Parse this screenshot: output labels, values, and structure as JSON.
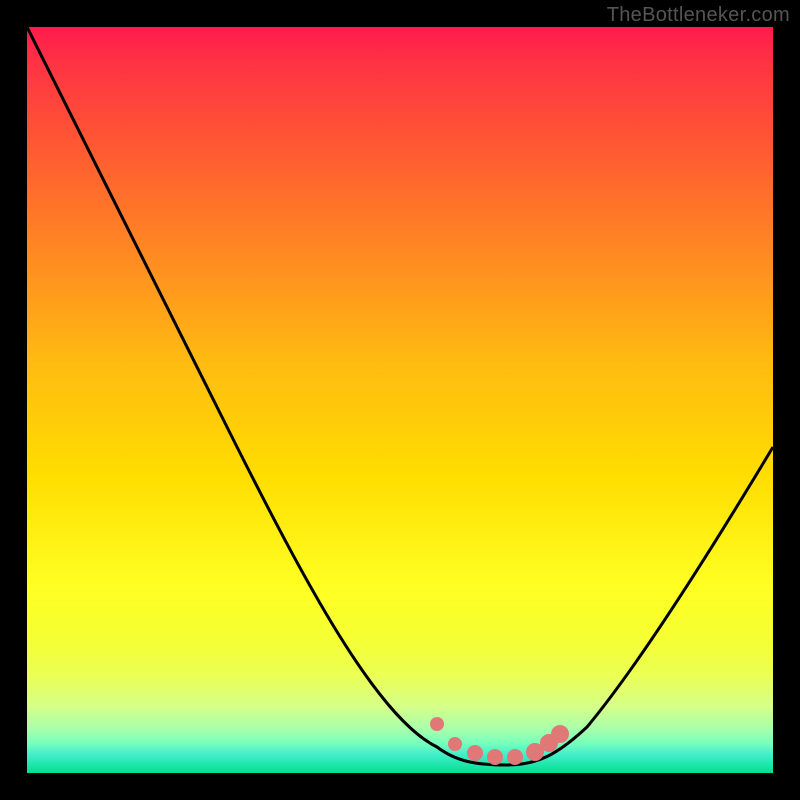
{
  "watermark": "TheBottleneker.com",
  "chart_data": {
    "type": "line",
    "title": "",
    "xlabel": "",
    "ylabel": "",
    "ylim": [
      0,
      100
    ],
    "xlim": [
      0,
      100
    ],
    "series": [
      {
        "name": "curve",
        "x": [
          0,
          10,
          20,
          30,
          40,
          50,
          55,
          60,
          63,
          66,
          70,
          75,
          80,
          90,
          100
        ],
        "y": [
          100,
          82,
          65,
          48,
          31,
          14,
          6,
          2,
          1,
          1,
          2,
          6,
          13,
          31,
          52
        ]
      }
    ],
    "markers": {
      "name": "highlighted-points",
      "x": [
        55.0,
        57.5,
        60.0,
        63.0,
        66.0,
        69.0,
        70.5,
        71.5
      ],
      "y": [
        5.5,
        3.0,
        1.8,
        1.2,
        1.2,
        2.0,
        3.0,
        4.2
      ]
    },
    "background_gradient": {
      "top": "#ff1a4d",
      "mid": "#ffff22",
      "bottom": "#00e090"
    }
  }
}
